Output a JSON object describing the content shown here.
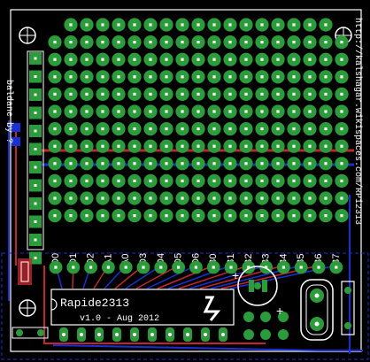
{
  "colors": {
    "background": "#000000",
    "pad": "#2a9d3a",
    "pad_hole": "#ffffff",
    "bottom_trace": "#1a2fd6",
    "top_trace": "#c0262c",
    "silkscreen": "#ffffff",
    "airwire": "#a050c8"
  },
  "board": {
    "url_text": "http://kalshagar.wikispaces.com/RPi2313",
    "credit_text": "baldane by ?",
    "chip_name": "Rapide2313",
    "version_text": "v1.0 - Aug 2012"
  },
  "pin_labels": [
    "D0",
    "D1",
    "D2",
    "A1",
    "A0",
    "D3",
    "D4",
    "D5",
    "D6",
    "B0",
    "B1",
    "B2",
    "B3",
    "B4",
    "B5",
    "B6",
    "B7"
  ],
  "grid": {
    "columns": 19,
    "rows": 12
  }
}
